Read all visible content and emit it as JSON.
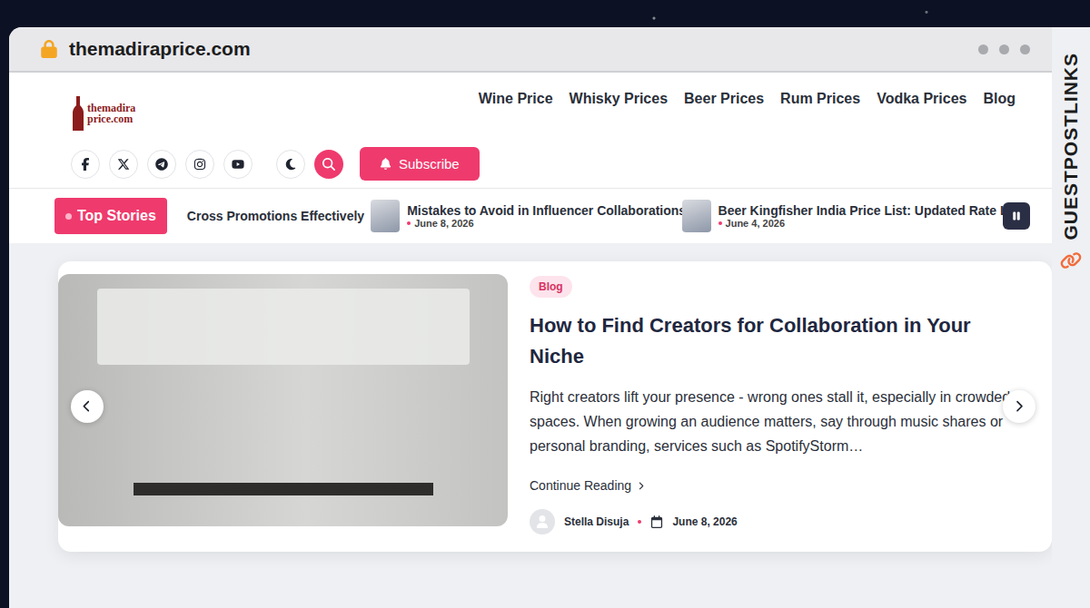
{
  "browser": {
    "url": "themadiraprice.com"
  },
  "logo": {
    "line1": "themadira",
    "line2": "price.com"
  },
  "nav": [
    {
      "label": "Wine Price"
    },
    {
      "label": "Whisky Prices"
    },
    {
      "label": "Beer Prices"
    },
    {
      "label": "Rum Prices"
    },
    {
      "label": "Vodka Prices"
    },
    {
      "label": "Blog"
    }
  ],
  "subscribe": {
    "label": "Subscribe"
  },
  "ticker": {
    "label": "Top Stories",
    "items": [
      {
        "kind": "partial",
        "title": "Cross Promotions Effectively",
        "date": ""
      },
      {
        "kind": "full",
        "title": "Mistakes to Avoid in Influencer Collaborations",
        "date": "June 8, 2026"
      },
      {
        "kind": "full",
        "title": "Beer Kingfisher India Price List: Updated Rate L",
        "date": "June 4, 2026"
      }
    ]
  },
  "hero": {
    "category": "Blog",
    "title": "How to Find Creators for Collaboration in Your Niche",
    "excerpt": "Right creators lift your presence - wrong ones stall it, especially in crowded spaces. When growing an audience matters, say through music shares or personal branding, services such as SpotifyStorm…",
    "read_more": "Continue Reading",
    "author": "Stella Disuja",
    "date": "June 8, 2026"
  },
  "watermark": {
    "text": "GUESTPOSTLINKS"
  }
}
